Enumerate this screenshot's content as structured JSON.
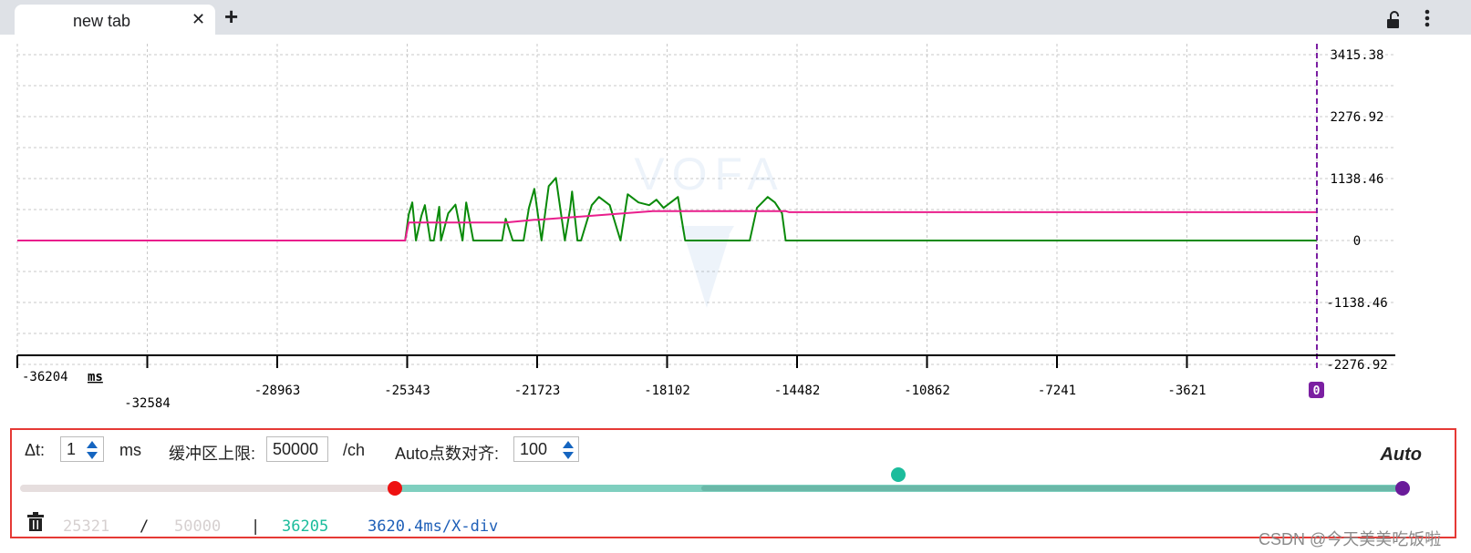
{
  "browser": {
    "tab_title": "new tab",
    "close_glyph": "✕",
    "new_tab_glyph": "+",
    "icons": [
      "close-icon",
      "plus-icon",
      "unlock-icon",
      "more-vert-icon"
    ]
  },
  "plot": {
    "watermark_text": "VOFA",
    "x_unit": "ms",
    "x_ticks_row1": [
      "-36204"
    ],
    "x_ticks_row2": [
      "-32584"
    ],
    "x_ticks_row3": [
      "-28963",
      "-25343",
      "-21723",
      "-18102",
      "-14482",
      "-10862",
      "-7241",
      "-3621"
    ],
    "y_ticks": [
      "3415.38",
      "2276.92",
      "1138.46",
      "0",
      "-1138.46",
      "-2276.92"
    ],
    "cursor_badge": "0",
    "colors": {
      "green": "#0a8a0a",
      "pink": "#e91e8c",
      "cursor": "#7b1fa2",
      "grid": "#c8c8c8"
    }
  },
  "chart_data": {
    "type": "line",
    "xlabel": "ms",
    "xlim": [
      -36204,
      0
    ],
    "ylim": [
      -2276.92,
      3415.38
    ],
    "series": [
      {
        "color": "#0a8a0a",
        "x": [
          -36204,
          -25400,
          -25300,
          -25200,
          -25100,
          -24950,
          -24850,
          -24700,
          -24600,
          -24450,
          -24400,
          -24200,
          -24000,
          -23800,
          -23700,
          -23500,
          -23200,
          -22700,
          -22600,
          -22400,
          -22250,
          -22100,
          -21950,
          -21800,
          -21600,
          -21400,
          -21200,
          -20950,
          -20800,
          -20750,
          -20600,
          -20500,
          -20200,
          -20000,
          -19700,
          -19400,
          -19200,
          -18900,
          -18600,
          -18400,
          -18200,
          -17800,
          -17600,
          -15800,
          -15600,
          -15300,
          -15100,
          -14900,
          -14800,
          -14600,
          -14400,
          -14100,
          0
        ],
        "y": [
          0,
          0,
          480,
          700,
          0,
          450,
          650,
          0,
          0,
          620,
          0,
          500,
          660,
          0,
          700,
          0,
          0,
          0,
          400,
          0,
          0,
          0,
          600,
          950,
          0,
          1000,
          1150,
          0,
          600,
          900,
          0,
          0,
          650,
          800,
          650,
          0,
          850,
          700,
          650,
          750,
          600,
          800,
          0,
          0,
          600,
          800,
          700,
          500,
          0,
          0,
          0,
          0,
          0
        ]
      },
      {
        "color": "#e91e8c",
        "x": [
          -36204,
          -25400,
          -25300,
          -22700,
          -22600,
          -21800,
          -21700,
          -18500,
          -18400,
          -14800,
          -14700,
          0
        ],
        "y": [
          0,
          0,
          330,
          330,
          330,
          380,
          380,
          540,
          540,
          540,
          520,
          520
        ]
      }
    ]
  },
  "controls": {
    "dt_label": "Δt:",
    "dt_value": "1",
    "dt_unit": "ms",
    "buffer_label": "缓冲区上限:",
    "buffer_value": "50000",
    "buffer_unit": "/ch",
    "align_label": "Auto点数对齐:",
    "align_value": "100",
    "auto_label": "Auto",
    "slider_fill_fraction": 0.726,
    "status_buffered": "25321",
    "status_sep1": "/",
    "status_limit": "50000",
    "status_sep2": "|",
    "status_points": "36205",
    "status_xdiv": "3620.4ms/X-div"
  },
  "watermark": "CSDN @今天美美吃饭啦"
}
